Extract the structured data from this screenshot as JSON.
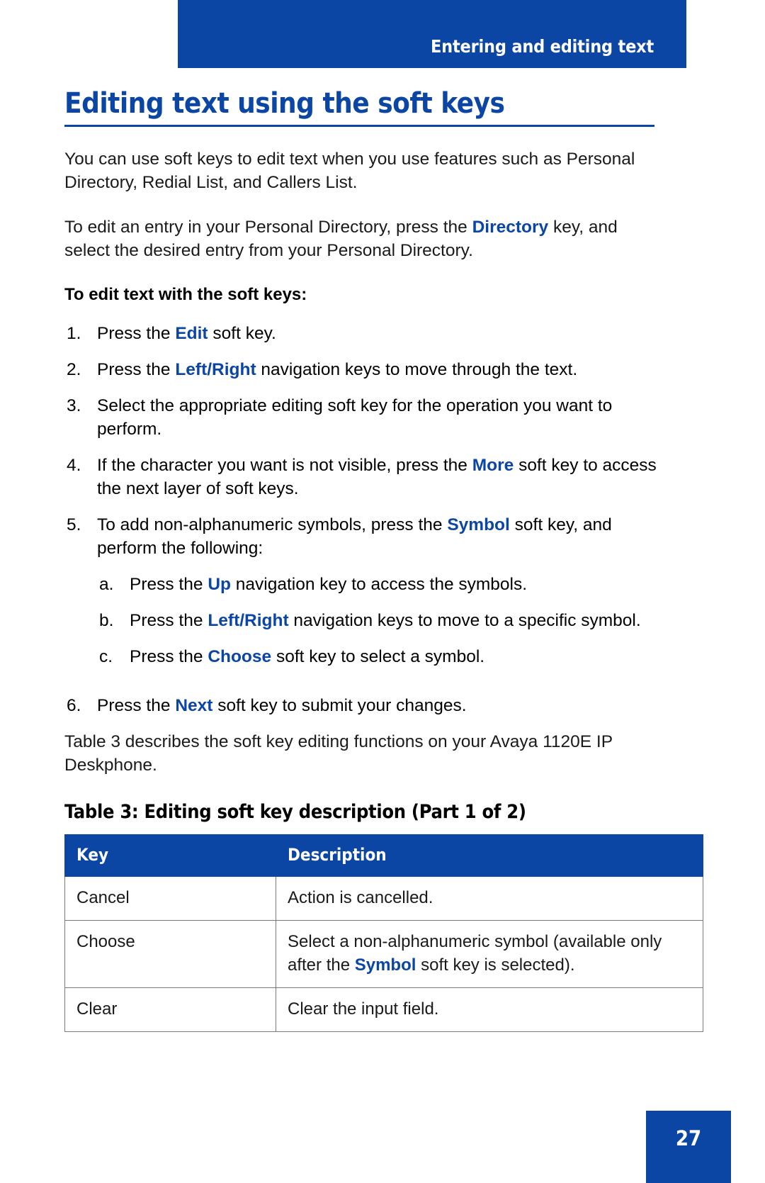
{
  "header": {
    "running_head": "Entering and editing text"
  },
  "page": {
    "title": "Editing text using the soft keys",
    "number": "27"
  },
  "colors": {
    "brand_blue": "#0B46A5",
    "text_black": "#1a1a1a",
    "white": "#ffffff"
  },
  "body": {
    "intro_1_part1": "You can use soft keys to edit text when you use features such as Personal Directory, Redial List, and Callers List.",
    "intro_2_part1": "To edit an entry in your Personal Directory, press the ",
    "intro_2_keyword": "Directory",
    "intro_2_part2": " key, and select the desired entry from your Personal Directory.",
    "procedure_heading": "To edit text with the soft keys:"
  },
  "steps": [
    {
      "num": "1.",
      "pre": "Press the ",
      "keyword": "Edit",
      "post": " soft key."
    },
    {
      "num": "2.",
      "pre": "Press the ",
      "keyword": "Left/Right",
      "post": " navigation keys to move through the text."
    },
    {
      "num": "3.",
      "pre": "Select the appropriate editing soft key for the operation you want to perform.",
      "keyword": "",
      "post": ""
    },
    {
      "num": "4.",
      "pre": "If the character you want is not visible, press the ",
      "keyword": "More",
      "post": " soft key to access the next layer of soft keys."
    },
    {
      "num": "5.",
      "pre": "To add non-alphanumeric symbols, press the ",
      "keyword": "Symbol",
      "post": " soft key, and perform the following:"
    },
    {
      "num": "6.",
      "pre": "Press the ",
      "keyword": "Next",
      "post": " soft key to submit your changes."
    }
  ],
  "substeps": [
    {
      "num": "a.",
      "pre": "Press the ",
      "keyword": "Up",
      "post": " navigation key to access the symbols."
    },
    {
      "num": "b.",
      "pre": "Press the ",
      "keyword": "Left/Right",
      "post": " navigation keys to move to a specific symbol."
    },
    {
      "num": "c.",
      "pre": "Press the ",
      "keyword": "Choose",
      "post": " soft key to select a symbol."
    }
  ],
  "table_intro": "Table 3 describes the soft key editing functions on your Avaya 1120E IP Deskphone.",
  "table": {
    "caption": "Table 3: Editing soft key description (Part 1 of 2)",
    "headers": [
      "Key",
      "Description"
    ],
    "rows": [
      {
        "key": "Cancel",
        "desc_pre": "Action is cancelled.",
        "desc_keyword": "",
        "desc_post": ""
      },
      {
        "key": "Choose",
        "desc_pre": "Select a non-alphanumeric symbol (available only after the ",
        "desc_keyword": "Symbol",
        "desc_post": " soft key is selected)."
      },
      {
        "key": "Clear",
        "desc_pre": "Clear the input field.",
        "desc_keyword": "",
        "desc_post": ""
      }
    ]
  }
}
